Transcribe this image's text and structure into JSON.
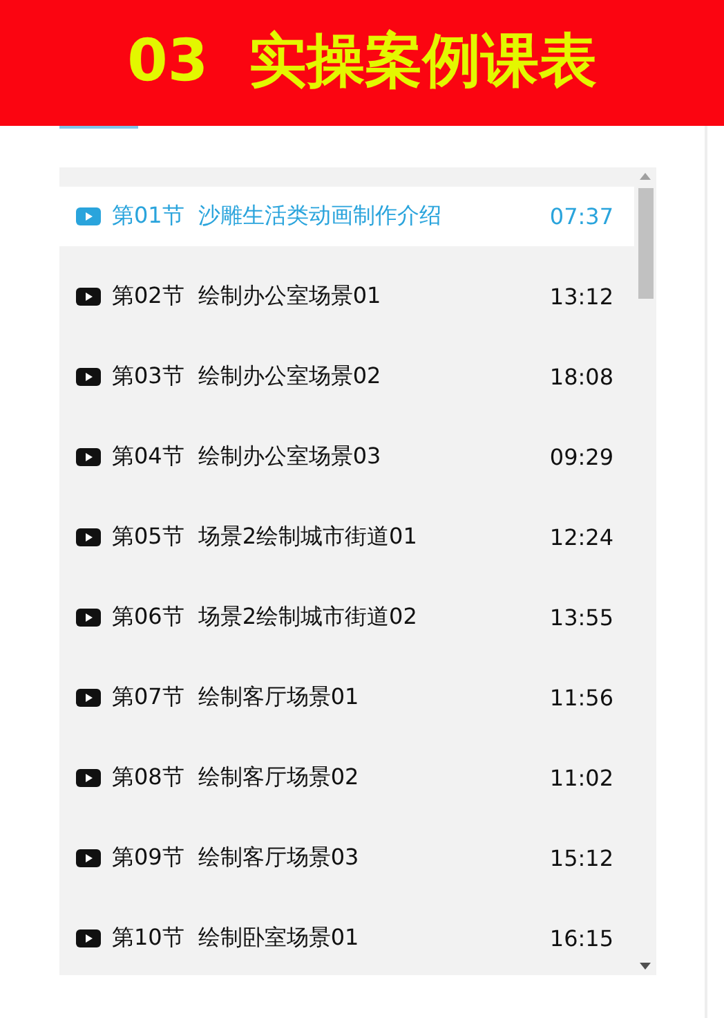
{
  "header": {
    "title": "03  实操案例课表"
  },
  "lessons": [
    {
      "number": "第01节",
      "title": "沙雕生活类动画制作介绍",
      "duration": "07:37",
      "selected": true
    },
    {
      "number": "第02节",
      "title": "绘制办公室场景01",
      "duration": "13:12",
      "selected": false
    },
    {
      "number": "第03节",
      "title": "绘制办公室场景02",
      "duration": "18:08",
      "selected": false
    },
    {
      "number": "第04节",
      "title": "绘制办公室场景03",
      "duration": "09:29",
      "selected": false
    },
    {
      "number": "第05节",
      "title": "场景2绘制城市街道01",
      "duration": "12:24",
      "selected": false
    },
    {
      "number": "第06节",
      "title": "场景2绘制城市街道02",
      "duration": "13:55",
      "selected": false
    },
    {
      "number": "第07节",
      "title": "绘制客厅场景01",
      "duration": "11:56",
      "selected": false
    },
    {
      "number": "第08节",
      "title": "绘制客厅场景02",
      "duration": "11:02",
      "selected": false
    },
    {
      "number": "第09节",
      "title": "绘制客厅场景03",
      "duration": "15:12",
      "selected": false
    },
    {
      "number": "第10节",
      "title": "绘制卧室场景01",
      "duration": "16:15",
      "selected": false
    }
  ]
}
